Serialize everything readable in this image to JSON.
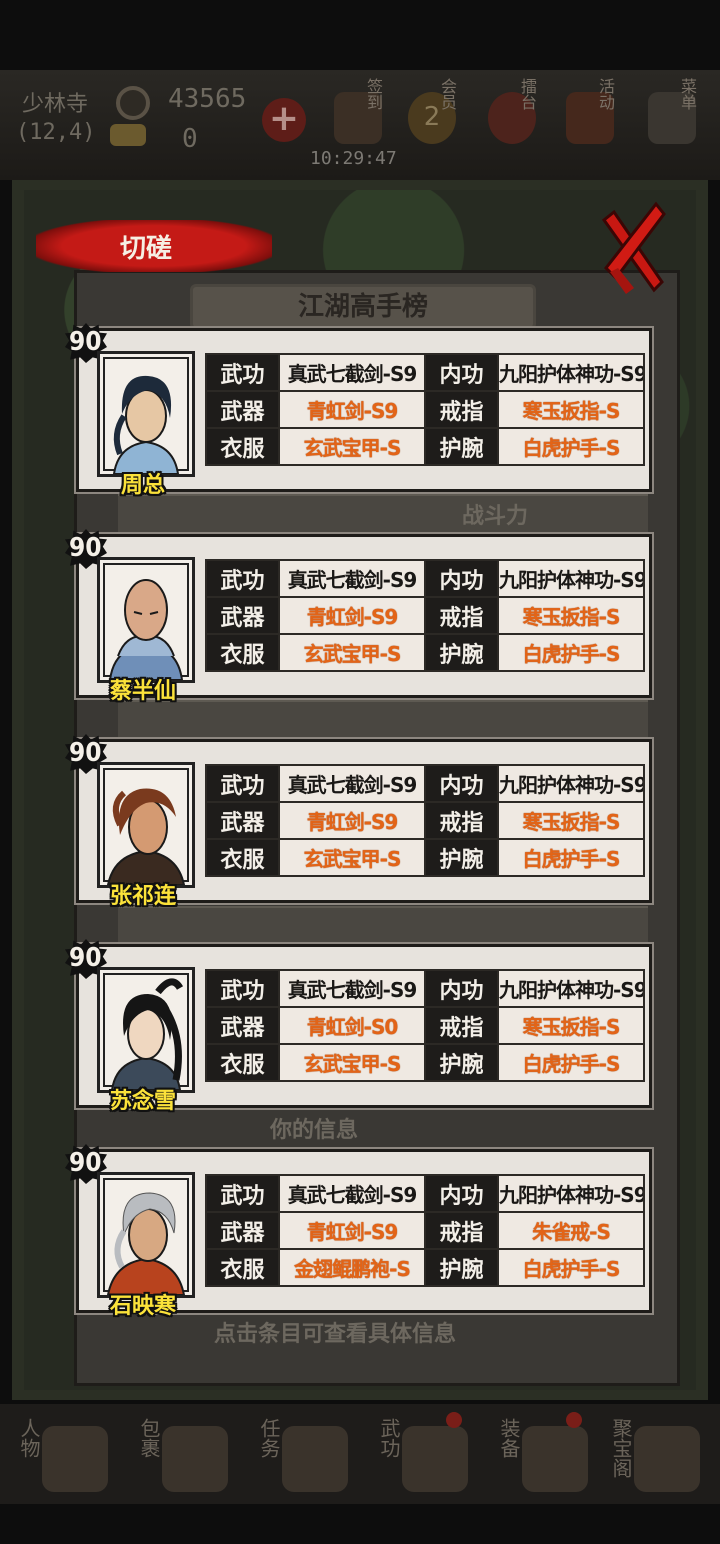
{
  "status_bar_top": "",
  "hud": {
    "location": "少林寺",
    "coords": "(12,4)",
    "coins": "43565",
    "gold": "0",
    "time": "10:29:47",
    "menus": [
      {
        "label": "签到"
      },
      {
        "label": "会员"
      },
      {
        "label": "擂台"
      },
      {
        "label": "活动"
      },
      {
        "label": "菜单"
      }
    ],
    "vip_level": "2"
  },
  "background": {
    "rank_title": "江湖高手榜",
    "battle_power": "战斗力",
    "your_info": "你的信息",
    "tip": "点击条目可查看具体信息"
  },
  "dialog": {
    "title": "切磋",
    "labels": {
      "martial": "武功",
      "inner": "内功",
      "weapon": "武器",
      "ring": "戒指",
      "armor": "衣服",
      "bracer": "护腕"
    },
    "characters": [
      {
        "level": "90",
        "name": "周总",
        "martial": "真武七截剑-S9",
        "inner": "九阳护体神功-S9",
        "weapon": "青虹剑-S9",
        "ring": "寒玉扳指-S",
        "armor": "玄武宝甲-S",
        "bracer": "白虎护手-S"
      },
      {
        "level": "90",
        "name": "蔡半仙",
        "martial": "真武七截剑-S9",
        "inner": "九阳护体神功-S9",
        "weapon": "青虹剑-S9",
        "ring": "寒玉扳指-S",
        "armor": "玄武宝甲-S",
        "bracer": "白虎护手-S"
      },
      {
        "level": "90",
        "name": "张祁连",
        "martial": "真武七截剑-S9",
        "inner": "九阳护体神功-S9",
        "weapon": "青虹剑-S9",
        "ring": "寒玉扳指-S",
        "armor": "玄武宝甲-S",
        "bracer": "白虎护手-S"
      },
      {
        "level": "90",
        "name": "苏念雪",
        "martial": "真武七截剑-S9",
        "inner": "九阳护体神功-S9",
        "weapon": "青虹剑-S0",
        "ring": "寒玉扳指-S",
        "armor": "玄武宝甲-S",
        "bracer": "白虎护手-S"
      },
      {
        "level": "90",
        "name": "石映寒",
        "martial": "真武七截剑-S9",
        "inner": "九阳护体神功-S9",
        "weapon": "青虹剑-S9",
        "ring": "朱雀戒-S",
        "armor": "金翅鲲鹏袍-S",
        "bracer": "白虎护手-S"
      }
    ]
  },
  "bottom_nav": [
    {
      "label": "人物"
    },
    {
      "label": "包裹"
    },
    {
      "label": "任务"
    },
    {
      "label": "武功"
    },
    {
      "label": "装备"
    },
    {
      "label": "聚宝阁"
    }
  ],
  "colors": {
    "equip_text": "#e36417",
    "name_text": "#fbe23a",
    "title_red": "#c41a16"
  }
}
